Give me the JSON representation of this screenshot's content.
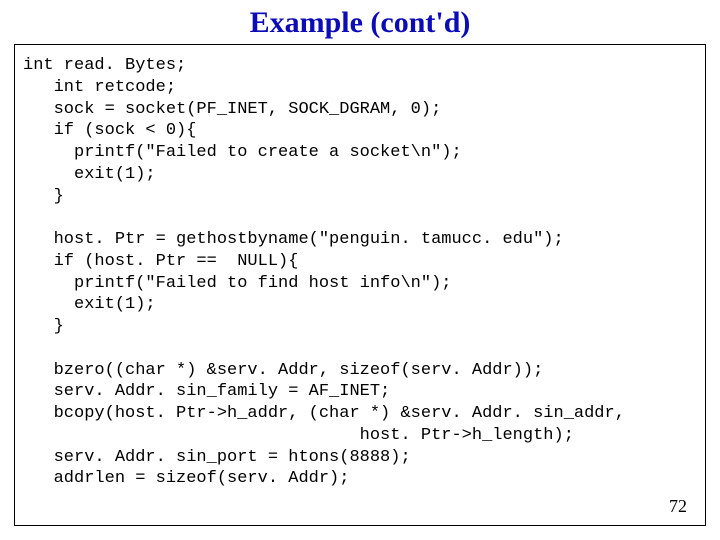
{
  "title": "Example (cont'd)",
  "code": "int read. Bytes;\n   int retcode;\n   sock = socket(PF_INET, SOCK_DGRAM, 0);\n   if (sock < 0){\n     printf(\"Failed to create a socket\\n\");\n     exit(1);\n   }\n\n   host. Ptr = gethostbyname(\"penguin. tamucc. edu\");\n   if (host. Ptr ==  NULL){\n     printf(\"Failed to find host info\\n\");\n     exit(1);\n   }\n\n   bzero((char *) &serv. Addr, sizeof(serv. Addr));\n   serv. Addr. sin_family = AF_INET;\n   bcopy(host. Ptr->h_addr, (char *) &serv. Addr. sin_addr,\n                                 host. Ptr->h_length);\n   serv. Addr. sin_port = htons(8888);\n   addrlen = sizeof(serv. Addr);",
  "page_number": "72"
}
